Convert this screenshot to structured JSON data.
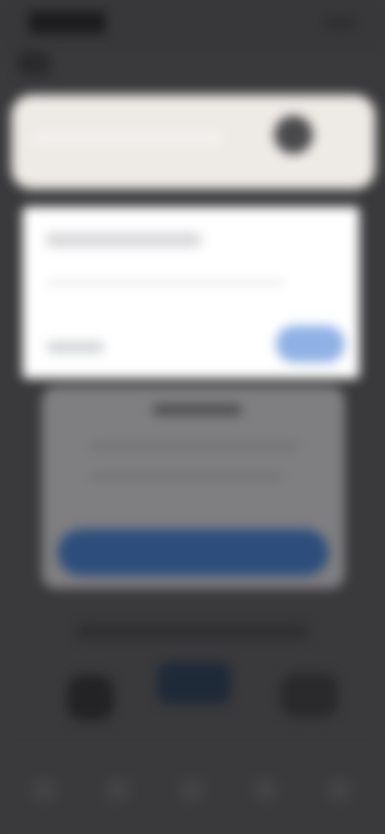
{
  "status_bar": {
    "time": "",
    "indicators": ""
  },
  "search": {
    "placeholder": ""
  },
  "card": {
    "title": "",
    "body": "",
    "label": "",
    "pill_label": ""
  },
  "dialog": {
    "heading": "",
    "text1": "",
    "text2": "",
    "cta_label": ""
  },
  "links": {
    "underline_text": ""
  },
  "icons": {
    "back": "back-arrow-icon",
    "avatar": "account-avatar-icon",
    "left_action": "action-icon",
    "center_action": "action-icon",
    "right_action": "action-icon"
  },
  "colors": {
    "background": "#3a3a3c",
    "search_bg": "#eeeae6",
    "card_bg": "#ffffff",
    "pill": "#8fb1e6",
    "dialog_bg": "#7f7f81",
    "cta": "#2d4e7c"
  }
}
